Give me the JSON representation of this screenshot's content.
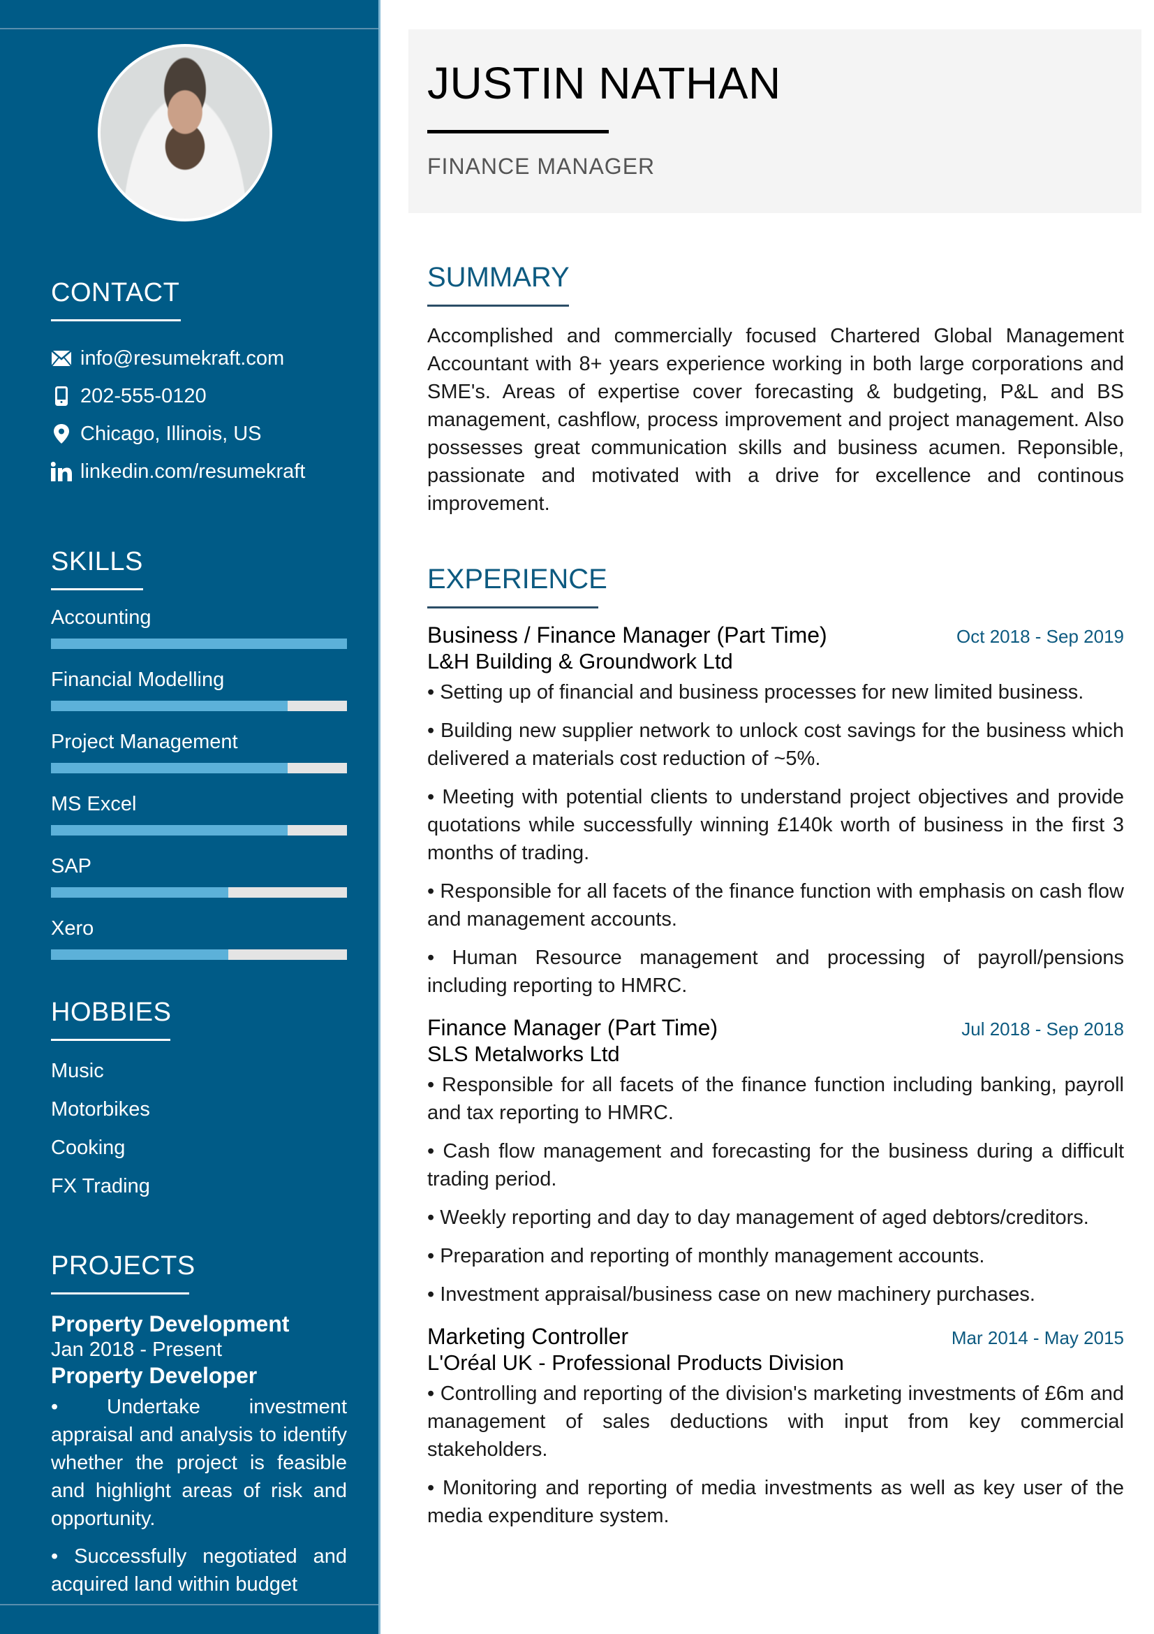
{
  "header": {
    "name": "JUSTIN NATHAN",
    "role": "FINANCE MANAGER"
  },
  "colors": {
    "sidebar": "#005b87",
    "accent": "#0d5a80",
    "skill_fill": "#5cb1d9",
    "skill_track": "#e4e4e4"
  },
  "sidebar": {
    "photo_alt": "profile-photo",
    "contact": {
      "title": "CONTACT",
      "items": [
        {
          "icon": "envelope-icon",
          "text": "info@resumekraft.com"
        },
        {
          "icon": "phone-icon",
          "text": "202-555-0120"
        },
        {
          "icon": "map-pin-icon",
          "text": "Chicago, Illinois, US"
        },
        {
          "icon": "linkedin-icon",
          "text": "linkedin.com/resumekraft"
        }
      ]
    },
    "skills": {
      "title": "SKILLS",
      "items": [
        {
          "label": "Accounting",
          "level": 1.0
        },
        {
          "label": "Financial Modelling",
          "level": 0.8
        },
        {
          "label": "Project Management",
          "level": 0.8
        },
        {
          "label": "MS Excel",
          "level": 0.8
        },
        {
          "label": "SAP",
          "level": 0.6
        },
        {
          "label": "Xero",
          "level": 0.6
        }
      ]
    },
    "hobbies": {
      "title": "HOBBIES",
      "items": [
        "Music",
        "Motorbikes",
        "Cooking",
        "FX Trading"
      ]
    },
    "projects": {
      "title": "PROJECTS",
      "items": [
        {
          "name": "Property Development",
          "date": "Jan 2018 - Present",
          "role": "Property Developer",
          "bullets": [
            "• Undertake investment appraisal and analysis to identify whether the project is feasible and highlight areas of risk and opportunity.",
            "• Successfully negotiated and acquired land within budget"
          ]
        }
      ]
    }
  },
  "summary": {
    "title": "SUMMARY",
    "text": "Accomplished and commercially focused Chartered Global Management Accountant with 8+ years experience working in both large corporations and SME's. Areas of expertise cover forecasting & budgeting, P&L and BS management, cashflow, process improvement and project management. Also possesses great communication skills and business acumen. Reponsible, passionate and motivated with a drive for excellence and continous improvement."
  },
  "experience": {
    "title": "EXPERIENCE",
    "jobs": [
      {
        "title": "Business / Finance Manager (Part Time)",
        "date": "Oct 2018 - Sep 2019",
        "company": "L&H Building & Groundwork Ltd",
        "bullets": [
          "• Setting up of financial and business processes for new limited business.",
          "• Building new supplier network to unlock cost savings for the business which delivered a materials cost reduction of ~5%.",
          "• Meeting with potential clients to understand project objectives and provide quotations while successfully winning £140k worth of business in the first 3 months of trading.",
          "• Responsible for all facets of the finance function with emphasis on cash flow and management accounts.",
          "• Human Resource management and processing of payroll/pensions including reporting to HMRC."
        ]
      },
      {
        "title": "Finance Manager (Part Time)",
        "date": "Jul 2018 - Sep 2018",
        "company": "SLS Metalworks Ltd",
        "bullets": [
          "• Responsible for all facets of the finance function including banking, payroll and tax reporting to HMRC.",
          "• Cash flow management and forecasting for the business during a difficult trading period.",
          "• Weekly reporting and day to day management of aged debtors/creditors.",
          "• Preparation and reporting of monthly management accounts.",
          "• Investment appraisal/business case on new machinery purchases."
        ]
      },
      {
        "title": "Marketing Controller",
        "date": "Mar 2014 - May 2015",
        "company": "L'Oréal UK - Professional Products Division",
        "bullets": [
          "• Controlling and reporting of the division's marketing investments of £6m and management of sales deductions with input from key commercial stakeholders.",
          "• Monitoring and reporting of media investments as well as key user of the media expenditure system."
        ]
      }
    ]
  }
}
